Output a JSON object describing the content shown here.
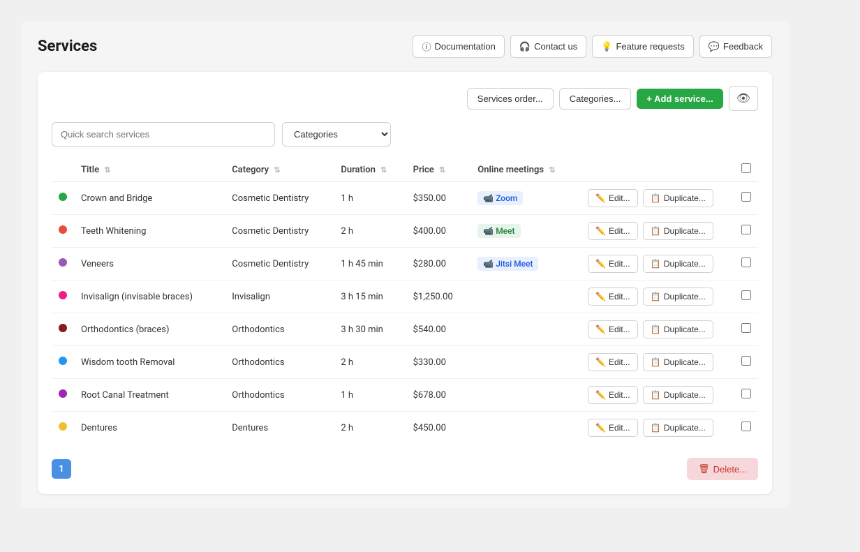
{
  "page": {
    "title": "Services"
  },
  "header": {
    "buttons": [
      {
        "label": "Documentation",
        "icon": "info-icon",
        "name": "documentation-button"
      },
      {
        "label": "Contact us",
        "icon": "headset-icon",
        "name": "contact-button"
      },
      {
        "label": "Feature requests",
        "icon": "lightbulb-icon",
        "name": "feature-requests-button"
      },
      {
        "label": "Feedback",
        "icon": "chat-icon",
        "name": "feedback-button"
      }
    ]
  },
  "toolbar": {
    "services_order_label": "Services order...",
    "categories_label": "Categories...",
    "add_service_label": "+ Add service..."
  },
  "search": {
    "placeholder": "Quick search services",
    "category_default": "Categories"
  },
  "table": {
    "columns": [
      {
        "label": "",
        "name": "dot-col"
      },
      {
        "label": "Title",
        "name": "title-col"
      },
      {
        "label": "Category",
        "name": "category-col"
      },
      {
        "label": "Duration",
        "name": "duration-col"
      },
      {
        "label": "Price",
        "name": "price-col"
      },
      {
        "label": "Online meetings",
        "name": "online-meetings-col"
      },
      {
        "label": "",
        "name": "actions-col"
      },
      {
        "label": "",
        "name": "checkbox-col"
      }
    ],
    "rows": [
      {
        "dot_color": "#28a745",
        "title": "Crown and Bridge",
        "category": "Cosmetic Dentistry",
        "duration": "1 h",
        "price": "$350.00",
        "meeting": "Zoom",
        "meeting_type": "zoom"
      },
      {
        "dot_color": "#e74c3c",
        "title": "Teeth Whitening",
        "category": "Cosmetic Dentistry",
        "duration": "2 h",
        "price": "$400.00",
        "meeting": "Meet",
        "meeting_type": "meet"
      },
      {
        "dot_color": "#9b59b6",
        "title": "Veneers",
        "category": "Cosmetic Dentistry",
        "duration": "1 h 45 min",
        "price": "$280.00",
        "meeting": "Jitsi Meet",
        "meeting_type": "jitsi"
      },
      {
        "dot_color": "#e91e8c",
        "title": "Invisalign (invisable braces)",
        "category": "Invisalign",
        "duration": "3 h 15 min",
        "price": "$1,250.00",
        "meeting": "",
        "meeting_type": ""
      },
      {
        "dot_color": "#8b1a1a",
        "title": "Orthodontics (braces)",
        "category": "Orthodontics",
        "duration": "3 h 30 min",
        "price": "$540.00",
        "meeting": "",
        "meeting_type": ""
      },
      {
        "dot_color": "#2196f3",
        "title": "Wisdom tooth Removal",
        "category": "Orthodontics",
        "duration": "2 h",
        "price": "$330.00",
        "meeting": "",
        "meeting_type": ""
      },
      {
        "dot_color": "#9c27b0",
        "title": "Root Canal Treatment",
        "category": "Orthodontics",
        "duration": "1 h",
        "price": "$678.00",
        "meeting": "",
        "meeting_type": ""
      },
      {
        "dot_color": "#f0c030",
        "title": "Dentures",
        "category": "Dentures",
        "duration": "2 h",
        "price": "$450.00",
        "meeting": "",
        "meeting_type": ""
      }
    ],
    "edit_label": "Edit...",
    "duplicate_label": "Duplicate..."
  },
  "footer": {
    "page_number": "1",
    "delete_label": "Delete..."
  }
}
